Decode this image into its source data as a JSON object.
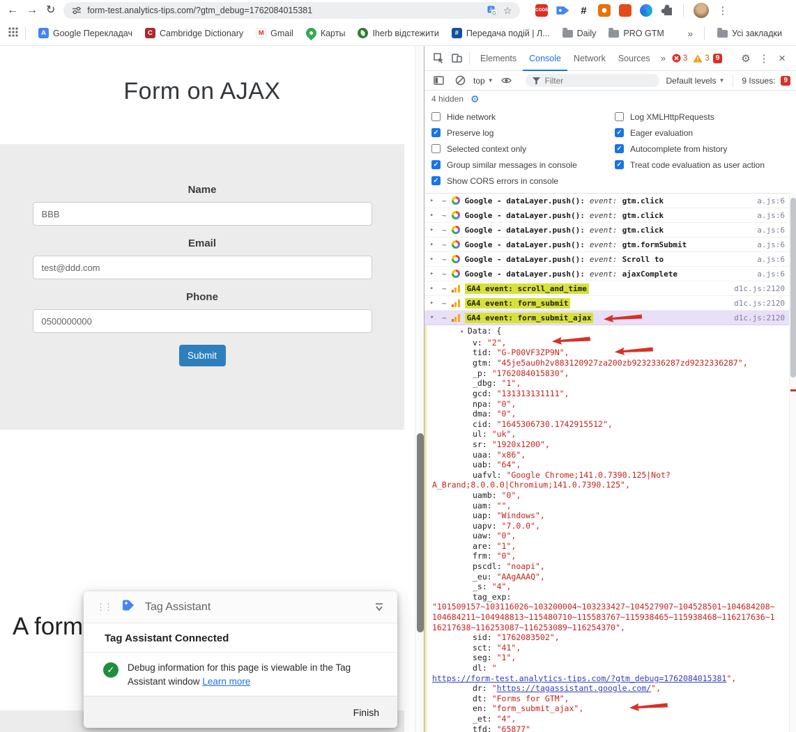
{
  "colors": {
    "accent_blue": "#1a73e8",
    "ga4_highlight": "#d8e138",
    "selected_row": "#e8e0f7",
    "annotation_red": "#d93025",
    "submit_blue": "#2e7fbe",
    "success_green": "#1e8e3e"
  },
  "browser": {
    "url": "form-test.analytics-tips.com/?gtm_debug=1762084015381",
    "extensions": [
      {
        "icon": "code",
        "label": "CODE"
      },
      {
        "icon": "tag"
      },
      {
        "icon": "hash"
      },
      {
        "icon": "orange-a"
      },
      {
        "icon": "orange-b"
      },
      {
        "icon": "teal"
      },
      {
        "icon": "puzzle"
      }
    ],
    "bookmarks": [
      {
        "icon": "translate",
        "label": "Google Перекладач"
      },
      {
        "icon": "dict",
        "label": "Cambridge Dictionary"
      },
      {
        "icon": "gmail",
        "label": "Gmail"
      },
      {
        "icon": "maps",
        "label": "Карты"
      },
      {
        "icon": "leaf",
        "label": "Iherb відстежити"
      },
      {
        "icon": "app",
        "label": "Передача подій | Л..."
      },
      {
        "icon": "folder",
        "label": "Daily"
      },
      {
        "icon": "folder",
        "label": "PRO GTM"
      }
    ],
    "overflow_chevron": "»",
    "all_bookmarks": "Усі закладки"
  },
  "page": {
    "title": "Form on AJAX",
    "form": {
      "name_label": "Name",
      "name_value": "BBB",
      "email_label": "Email",
      "email_value": "test@ddd.com",
      "phone_label": "Phone",
      "phone_value": "0500000000",
      "submit_label": "Submit"
    },
    "partial_heading": "A form i"
  },
  "tag_assistant": {
    "title": "Tag Assistant",
    "connected": "Tag Assistant Connected",
    "body": "Debug information for this page is viewable in the Tag Assistant window",
    "link": "Learn more",
    "finish": "Finish"
  },
  "devtools": {
    "tabs": [
      {
        "label": "Elements"
      },
      {
        "label": "Console",
        "active": true
      },
      {
        "label": "Network"
      },
      {
        "label": "Sources"
      }
    ],
    "tabbar": {
      "error_count": "3",
      "warning_count": "3",
      "issues_count": "9"
    },
    "toolbar": {
      "context": "top",
      "filter_placeholder": "Filter",
      "levels": "Default levels",
      "issues_label": "9 Issues:",
      "issues_count": "9"
    },
    "hidden_label": "4 hidden",
    "settings": {
      "col1": [
        {
          "label": "Hide network",
          "checked": false
        },
        {
          "label": "Preserve log",
          "checked": true
        },
        {
          "label": "Selected context only",
          "checked": false
        },
        {
          "label": "Group similar messages in console",
          "checked": true
        },
        {
          "label": "Show CORS errors in console",
          "checked": true
        }
      ],
      "col2": [
        {
          "label": "Log XMLHttpRequests",
          "checked": false
        },
        {
          "label": "Eager evaluation",
          "checked": true
        },
        {
          "label": "Autocomplete from history",
          "checked": true
        },
        {
          "label": "Treat code evaluation as user action",
          "checked": true
        }
      ]
    },
    "datalayer_messages": [
      {
        "prefix": "Google - dataLayer.push():",
        "event_label": "event:",
        "event": "gtm.click",
        "source": "a.js:6"
      },
      {
        "prefix": "Google - dataLayer.push():",
        "event_label": "event:",
        "event": "gtm.click",
        "source": "a.js:6"
      },
      {
        "prefix": "Google - dataLayer.push():",
        "event_label": "event:",
        "event": "gtm.click",
        "source": "a.js:6"
      },
      {
        "prefix": "Google - dataLayer.push():",
        "event_label": "event:",
        "event": "gtm.formSubmit",
        "source": "a.js:6"
      },
      {
        "prefix": "Google - dataLayer.push():",
        "event_label": "event:",
        "event": "Scroll to",
        "source": "a.js:6"
      },
      {
        "prefix": "Google - dataLayer.push():",
        "event_label": "event:",
        "event": "ajaxComplete",
        "source": "a.js:6"
      }
    ],
    "ga4_messages": [
      {
        "label": "GA4 event:",
        "event": "scroll_and_time",
        "source": "d1c.js:2120"
      },
      {
        "label": "GA4 event:",
        "event": "form_submit",
        "source": "d1c.js:2120"
      },
      {
        "label": "GA4 event:",
        "event": "form_submit_ajax",
        "source": "d1c.js:2120",
        "selected": true,
        "arrow": true
      }
    ],
    "tree": [
      {
        "k": "Data: {",
        "head": true
      },
      {
        "k": "v: ",
        "v": "\"2\",",
        "arrow": true
      },
      {
        "k": "tid: ",
        "v": "\"G-P00VF3ZP9N\",",
        "arrow": true
      },
      {
        "k": "gtm: ",
        "v": "\"45je5au0h2v883120927za200zb9232336287zd9232336287\","
      },
      {
        "k": "_p: ",
        "v": "\"1762084015830\","
      },
      {
        "k": "_dbg: ",
        "v": "\"1\","
      },
      {
        "k": "gcd: ",
        "v": "\"131313131111\","
      },
      {
        "k": "npa: ",
        "v": "\"0\","
      },
      {
        "k": "dma: ",
        "v": "\"0\","
      },
      {
        "k": "cid: ",
        "v": "\"1645306730.1742915512\","
      },
      {
        "k": "ul: ",
        "v": "\"uk\","
      },
      {
        "k": "sr: ",
        "v": "\"1920x1200\","
      },
      {
        "k": "uaa: ",
        "v": "\"x86\","
      },
      {
        "k": "uab: ",
        "v": "\"64\","
      },
      {
        "k": "uafvl: ",
        "v": "\"Google Chrome;141.0.7390.125|Not?"
      },
      {
        "k": "",
        "v": "A_Brand;8.0.0.0|Chromium;141.0.7390.125\",",
        "noind": true
      },
      {
        "k": "uamb: ",
        "v": "\"0\","
      },
      {
        "k": "uam: ",
        "v": "\"\","
      },
      {
        "k": "uap: ",
        "v": "\"Windows\","
      },
      {
        "k": "uapv: ",
        "v": "\"7.0.0\","
      },
      {
        "k": "uaw: ",
        "v": "\"0\","
      },
      {
        "k": "are: ",
        "v": "\"1\","
      },
      {
        "k": "frm: ",
        "v": "\"0\","
      },
      {
        "k": "pscdl: ",
        "v": "\"noapi\","
      },
      {
        "k": "_eu: ",
        "v": "\"AAgAAAQ\","
      },
      {
        "k": "_s: ",
        "v": "\"4\","
      },
      {
        "k": "tag_exp:"
      },
      {
        "k": "",
        "v": "\"101509157~103116026~103200004~103233427~104527907~104528501~104684208~104684211~104948813~115480710~115583767~115938465~115938468~116217636~116217638~116253087~116253089~116254370\",",
        "noind": true
      },
      {
        "k": "sid: ",
        "v": "\"1762083502\","
      },
      {
        "k": "sct: ",
        "v": "\"41\","
      },
      {
        "k": "seg: ",
        "v": "\"1\","
      },
      {
        "k": "dl: ",
        "v": "\""
      },
      {
        "k": "",
        "link": "https://form-test.analytics-tips.com/?gtm_debug=1762084015381",
        "suffix": "\",",
        "noind": true
      },
      {
        "k": "dr: ",
        "v": "\"",
        "link": "https://tagassistant.google.com/",
        "suffix": "\","
      },
      {
        "k": "dt: ",
        "v": "\"Forms for GTM\","
      },
      {
        "k": "en: ",
        "v": "\"form_submit_ajax\",",
        "arrow": true
      },
      {
        "k": "_et: ",
        "v": "\"4\","
      },
      {
        "k": "tfd: ",
        "v": "\"65877\""
      }
    ]
  }
}
